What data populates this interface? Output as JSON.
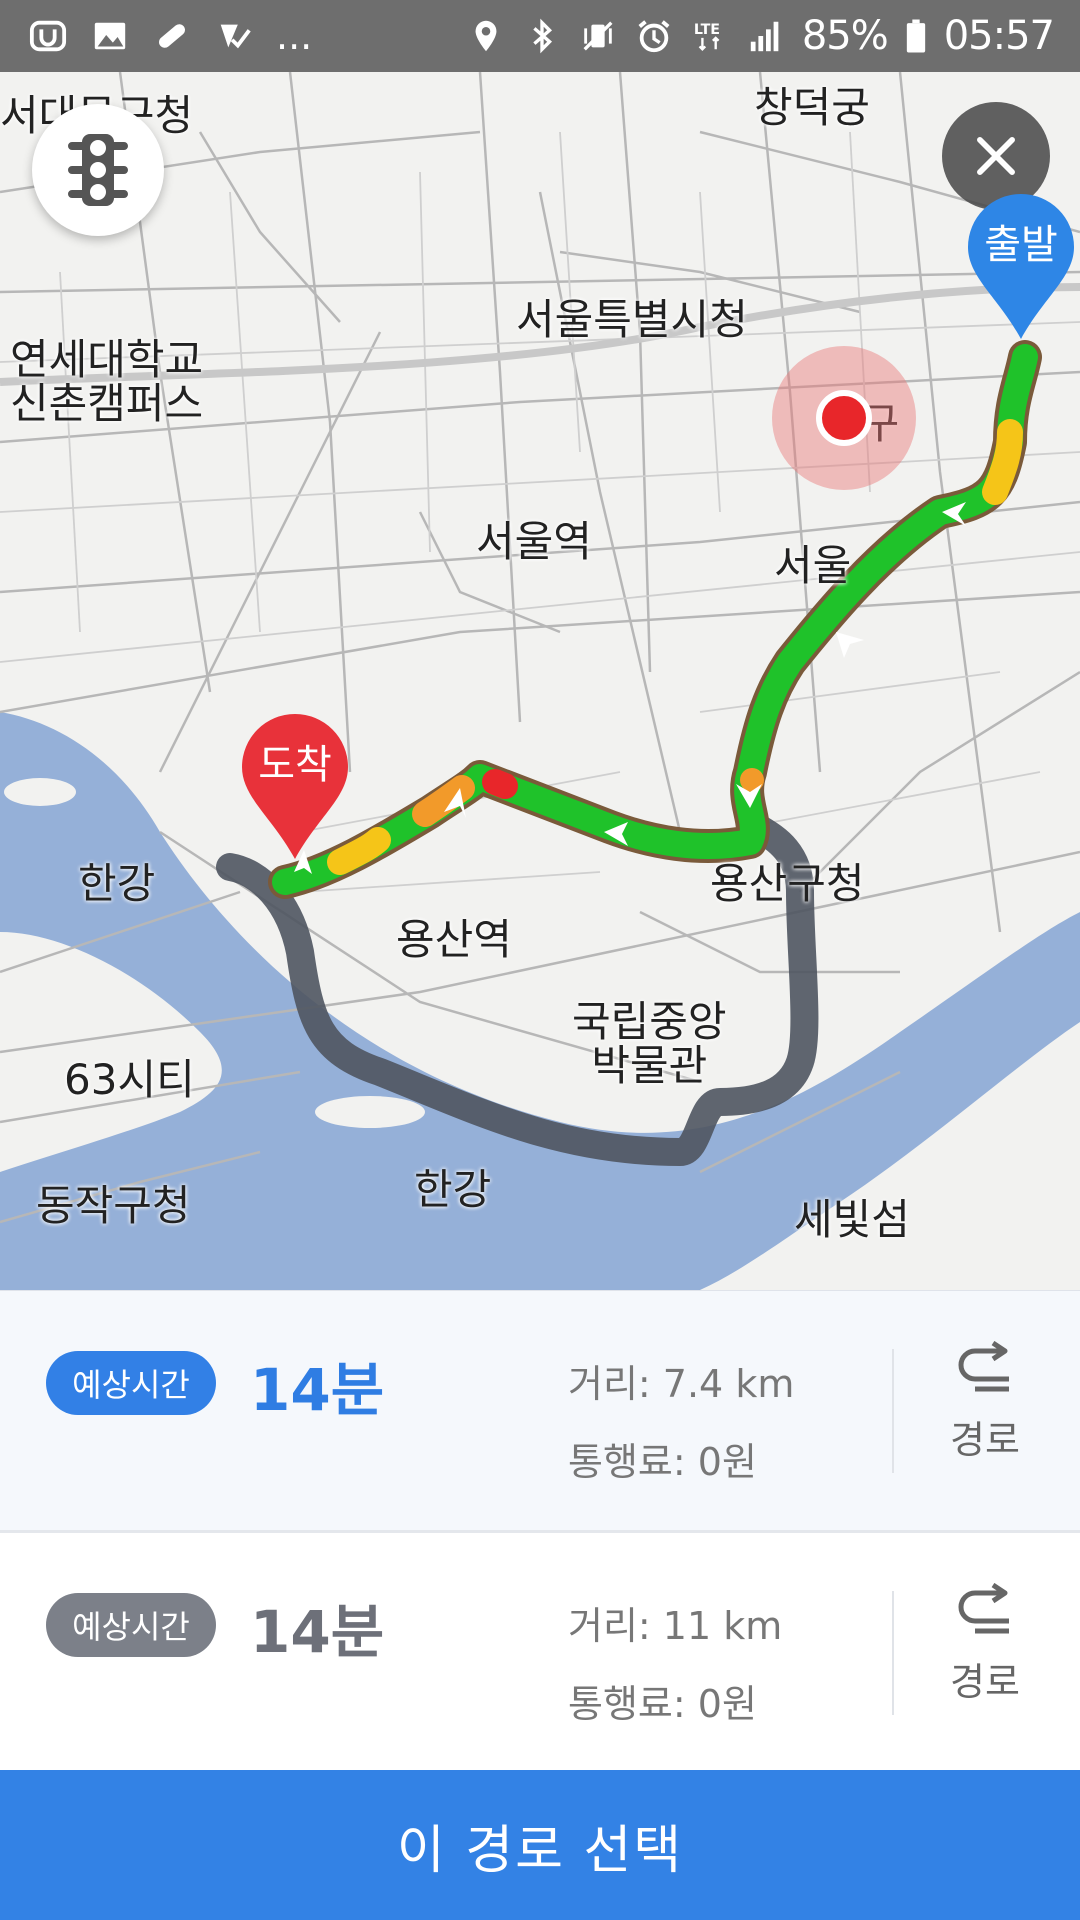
{
  "status_bar": {
    "battery": "85%",
    "time": "05:57",
    "more_indicator": "...",
    "network": "LTE",
    "icons_left": [
      "app-icon",
      "image-icon",
      "pill-icon",
      "check-icon"
    ],
    "icons_right": [
      "location-icon",
      "bluetooth-icon",
      "vibrate-icon",
      "alarm-icon",
      "lte-icon",
      "signal-icon",
      "battery-icon"
    ]
  },
  "map": {
    "labels": {
      "seodaemun": "서대문구청",
      "changdeokgung": "창덕궁",
      "cityhall": "서울특별시청",
      "yonsei_line1": "연세대학교",
      "yonsei_line2": "신촌캠퍼스",
      "junggu": "중구",
      "seoul_station": "서울역",
      "seoul": "서울",
      "hangang_left": "한강",
      "yongsan_gu_office": "용산구청",
      "yongsan_station": "용산역",
      "museum_line1": "국립중앙",
      "museum_line2": "박물관",
      "sixty_three": "63시티",
      "hangang_bottom": "한강",
      "dongjak": "동작구청",
      "sebitseom": "세빛섬"
    },
    "start_pin_label": "출발",
    "end_pin_label": "도착",
    "colors": {
      "route_green": "#1fc22a",
      "route_yellow": "#f5c518",
      "route_red": "#e8262a",
      "alt_route": "#5a606b",
      "river": "#95b0d8",
      "start_pin": "#2e86e6",
      "end_pin": "#e8323a"
    }
  },
  "routes": [
    {
      "badge": "예상시간",
      "time": "14분",
      "distance": "거리: 7.4 km",
      "toll": "통행료: 0원",
      "detail_label": "경로",
      "selected": true
    },
    {
      "badge": "예상시간",
      "time": "14분",
      "distance": "거리: 11 km",
      "toll": "통행료: 0원",
      "detail_label": "경로",
      "selected": false
    }
  ],
  "select_button": "이 경로 선택"
}
